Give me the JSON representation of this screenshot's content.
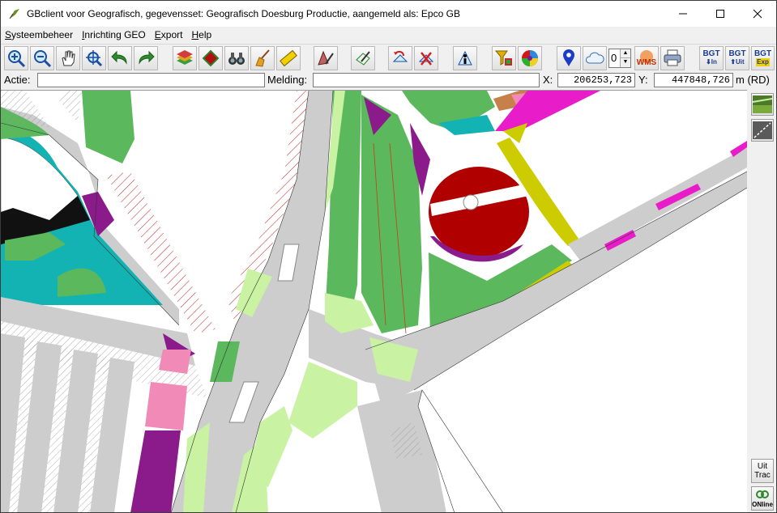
{
  "window": {
    "title": "GBclient voor Geografisch, gegevensset: Geografisch Doesburg Productie, aangemeld als: Epco GB",
    "minimize_glyph": "—",
    "maximize_glyph": "☐",
    "close_glyph": "✕"
  },
  "menu": {
    "items": [
      {
        "label": "Systeembeheer",
        "accel": "S"
      },
      {
        "label": "Inrichting GEO",
        "accel": "I"
      },
      {
        "label": "Export",
        "accel": "E"
      },
      {
        "label": "Help",
        "accel": "H"
      }
    ]
  },
  "toolbar": {
    "spin_value": "0",
    "wms_label": "WMS",
    "bgt_in_top": "BGT",
    "bgt_in_bottom": "In",
    "bgt_uit_top": "BGT",
    "bgt_uit_bottom": "Uit",
    "bgt_exp_top": "BGT",
    "bgt_exp_bottom": "Exp"
  },
  "status": {
    "actie_label": "Actie:",
    "actie_value": "",
    "melding_label": "Melding:",
    "melding_value": "",
    "x_label": "X:",
    "x_value": "206253,723",
    "y_label": "Y:",
    "y_value": "447848,726",
    "unit_label": "m (RD)"
  },
  "side": {
    "uit_trac_line1": "Uit",
    "uit_trac_line2": "Trac",
    "online_label": "ONline"
  },
  "colors": {
    "green": "#5cb85c",
    "light_green": "#c9f2a3",
    "teal": "#14b3b3",
    "purple": "#8b1a8b",
    "darkred": "#b00000",
    "yellow": "#cccc00",
    "pink": "#f28ab8",
    "magenta": "#e81cc8",
    "road": "#cdcdcd"
  }
}
